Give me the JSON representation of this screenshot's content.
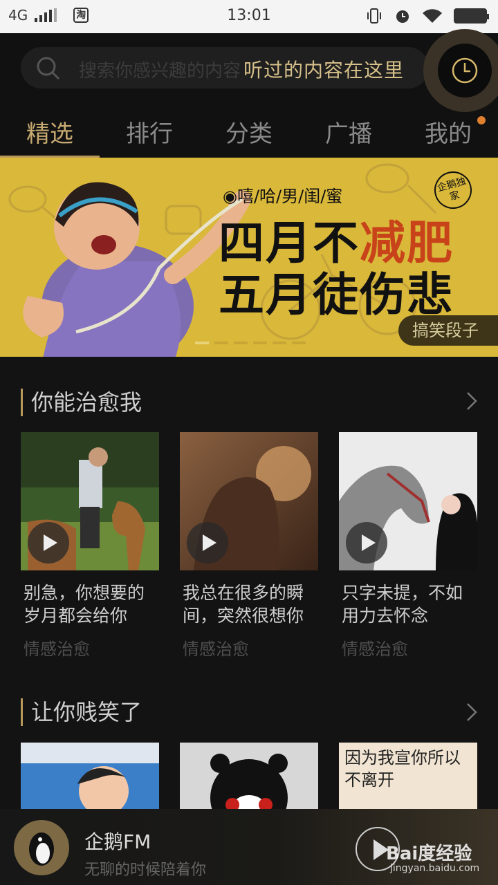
{
  "status_bar": {
    "network": "4G",
    "time": "13:01",
    "app_icon_label": "淘"
  },
  "header": {
    "search_placeholder": "搜索你感兴趣的内容",
    "history_tooltip": "听过的内容在这里",
    "tabs": [
      {
        "label": "精选",
        "active": true
      },
      {
        "label": "排行"
      },
      {
        "label": "分类"
      },
      {
        "label": "广播"
      },
      {
        "label": "我的",
        "has_badge": true
      }
    ]
  },
  "banner": {
    "tagline": "◉嘻/哈/男/闺/蜜",
    "line1_pre": "四月不",
    "line1_highlight": "减肥",
    "line2": "五月徒伤悲",
    "badge": "企鹅独家",
    "category": "搞笑段子",
    "page_count": 6,
    "current_page": 1
  },
  "sections": [
    {
      "title": "你能治愈我",
      "items": [
        {
          "title": "别急，你想要的岁月都会给你",
          "category": "情感治愈"
        },
        {
          "title": "我总在很多的瞬间，突然很想你",
          "category": "情感治愈"
        },
        {
          "title": "只字未提，不如用力去怀念",
          "category": "情感治愈"
        }
      ]
    },
    {
      "title": "让你贱笑了",
      "items": [
        {
          "thumb_text": ""
        },
        {
          "thumb_text": ""
        },
        {
          "thumb_text": "因为我宣你所以不离开"
        }
      ]
    }
  ],
  "player": {
    "name": "企鹅FM",
    "subtitle": "无聊的时候陪着你"
  },
  "watermark": {
    "brand": "Bai度经验",
    "url": "jingyan.baidu.com"
  },
  "colors": {
    "accent": "#c7aa71",
    "banner_bg": "#d9b83a",
    "highlight_red": "#c8421a",
    "badge_orange": "#e0802e"
  }
}
